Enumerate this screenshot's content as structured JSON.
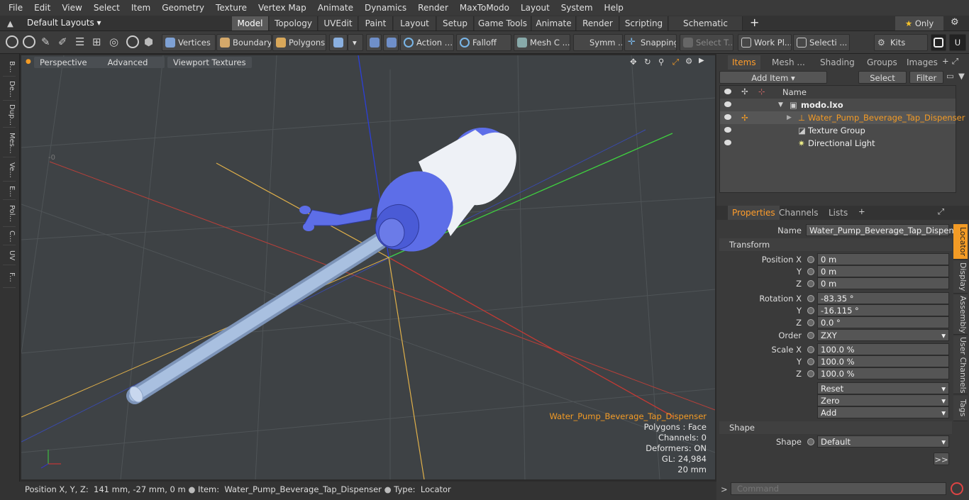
{
  "menu": [
    "File",
    "Edit",
    "View",
    "Select",
    "Item",
    "Geometry",
    "Texture",
    "Vertex Map",
    "Animate",
    "Dynamics",
    "Render",
    "MaxToModo",
    "Layout",
    "System",
    "Help"
  ],
  "layouts_label": "Default Layouts",
  "tabs": [
    "Model",
    "Topology",
    "UVEdit",
    "Paint",
    "Layout",
    "Setup",
    "Game Tools",
    "Animate",
    "Render",
    "Scripting",
    "Schematic Fusion"
  ],
  "only_label": "Only",
  "toolbar": {
    "vertices": "Vertices",
    "boundary": "Boundary",
    "polygons": "Polygons",
    "action": "Action",
    "falloff": "Falloff",
    "mesh": "Mesh C ...",
    "symm": "Symm ...",
    "snapping": "Snapping",
    "select_t": "Select T...",
    "work_pl": "Work Pl...",
    "selecti": "Selecti ...",
    "kits": "Kits"
  },
  "left_tabs": [
    "B...",
    "De...",
    "Dup...",
    "Mes...",
    "Ve...",
    "E...",
    "Pol...",
    "C...",
    "UV",
    "F..."
  ],
  "viewport": {
    "perspective": "Perspective",
    "advanced": "Advanced",
    "textures": "Viewport Textures",
    "info": {
      "name": "Water_Pump_Beverage_Tap_Dispenser",
      "polygons": "Polygons : Face",
      "channels": "Channels: 0",
      "deformers": "Deformers: ON",
      "gl": "GL: 24,984",
      "scale": "20 mm"
    }
  },
  "status": {
    "pos_label": "Position X, Y, Z:",
    "pos_value": "141 mm, -27 mm, 0 m",
    "item_label": "Item:",
    "item_value": "Water_Pump_Beverage_Tap_Dispenser",
    "type_label": "Type:",
    "type_value": "Locator"
  },
  "items_panel": {
    "tabs": [
      "Items",
      "Mesh ...",
      "Shading",
      "Groups",
      "Images"
    ],
    "add_item": "Add Item",
    "select": "Select",
    "filter": "Filter",
    "col_name": "Name",
    "rows": [
      "modo.lxo",
      "Water_Pump_Beverage_Tap_Dispenser",
      "Texture Group",
      "Directional Light"
    ]
  },
  "props": {
    "tabs": [
      "Properties",
      "Channels",
      "Lists"
    ],
    "name_label": "Name",
    "name_value": "Water_Pump_Beverage_Tap_Dispenser",
    "transform": "Transform",
    "position_label": "Position X",
    "pos": [
      "0 m",
      "0 m",
      "0 m"
    ],
    "rotation_label": "Rotation X",
    "rot": [
      "-83.35 °",
      "-16.115 °",
      "0.0 °"
    ],
    "y": "Y",
    "z": "Z",
    "order_label": "Order",
    "order": "ZXY",
    "scale_label": "Scale X",
    "scale": [
      "100.0 %",
      "100.0 %",
      "100.0 %"
    ],
    "reset": "Reset",
    "zero": "Zero",
    "add": "Add",
    "shape_section": "Shape",
    "shape_label": "Shape",
    "shape_value": "Default",
    "more": ">>"
  },
  "side_tabs": [
    "Locator",
    "Display",
    "Assembly",
    "User Channels",
    "Tags"
  ],
  "command_placeholder": "Command",
  "colors": {
    "accent": "#f39b25",
    "model_blue": "#5d6ee8",
    "tube": "#9db4d8"
  }
}
